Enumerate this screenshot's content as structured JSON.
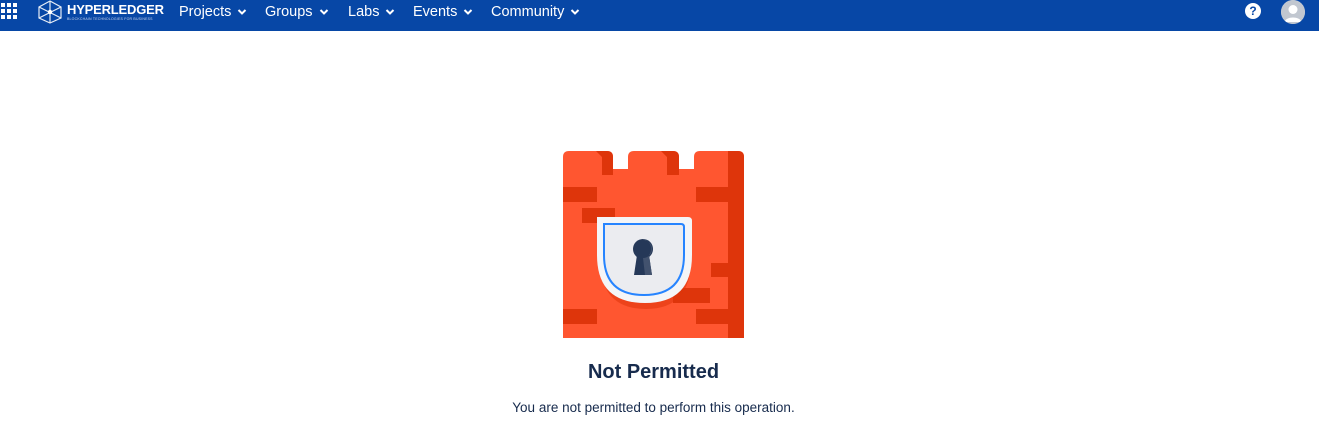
{
  "topbar": {
    "brand": {
      "name": "HYPERLEDGER",
      "tagline": "BLOCKCHAIN TECHNOLOGIES FOR BUSINESS"
    },
    "nav": [
      {
        "label": "Projects"
      },
      {
        "label": "Groups"
      },
      {
        "label": "Labs"
      },
      {
        "label": "Events"
      },
      {
        "label": "Community"
      }
    ],
    "help_label": "?",
    "colors": {
      "bar": "#0747a6",
      "text": "#ffffff"
    },
    "icons": {
      "app_switcher": "grid-icon",
      "nav_dropdown": "chevron-down-icon",
      "help": "question-icon",
      "avatar": "user-avatar-icon"
    }
  },
  "main": {
    "title": "Not Permitted",
    "message": "You are not permitted to perform this operation.",
    "illustration": "locked-castle-keyhole",
    "colors": {
      "wall": "#ff5630",
      "wall_shadow": "#de350b",
      "shield": "#ebecf0",
      "shield_outline": "#2684ff",
      "keyhole": "#253858"
    }
  }
}
